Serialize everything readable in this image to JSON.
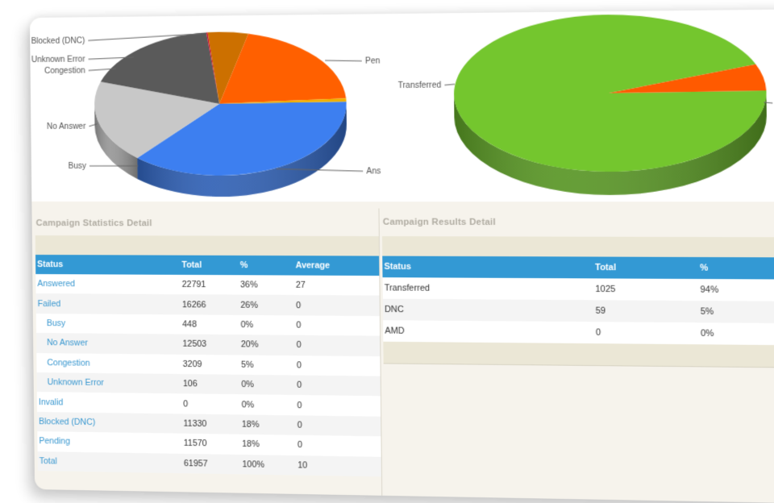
{
  "colors": {
    "header_blue": "#3399d4",
    "link_blue": "#3a98d0",
    "band_beige": "#ebe7d6",
    "background": "#f6f3ec"
  },
  "chart_data": [
    {
      "type": "pie",
      "title": "Campaign Statistics",
      "style": "3d",
      "slices": [
        {
          "label": "Answered",
          "short_label": "Ans",
          "value": 22791,
          "percent": 36,
          "color": "#3d7ff0"
        },
        {
          "label": "Pending",
          "short_label": "Pen",
          "value": 11570,
          "percent": 18,
          "color": "#c8c8c8"
        },
        {
          "label": "Blocked (DNC)",
          "short_label": "Blocked (DNC)",
          "value": 11330,
          "percent": 18,
          "color": "#5a5a5a"
        },
        {
          "label": "Unknown Error",
          "short_label": "Unknown Error",
          "value": 106,
          "percent": 0,
          "color": "#cc1133"
        },
        {
          "label": "Congestion",
          "short_label": "Congestion",
          "value": 3209,
          "percent": 5,
          "color": "#cc7000"
        },
        {
          "label": "No Answer",
          "short_label": "No Answer",
          "value": 12503,
          "percent": 20,
          "color": "#ff6000"
        },
        {
          "label": "Busy",
          "short_label": "Busy",
          "value": 448,
          "percent": 0,
          "color": "#f0b000"
        }
      ]
    },
    {
      "type": "pie",
      "title": "Campaign Results",
      "style": "3d",
      "slices": [
        {
          "label": "Transferred",
          "short_label": "Transferred",
          "value": 1025,
          "percent": 94,
          "color": "#74c62e"
        },
        {
          "label": "DNC",
          "short_label": "DNC",
          "value": 59,
          "percent": 5,
          "color": "#ff5a00"
        },
        {
          "label": "AMD",
          "short_label": "AMD",
          "value": 0,
          "percent": 0,
          "color": "#999999"
        }
      ]
    }
  ],
  "stats": {
    "title": "Campaign Statistics Detail",
    "columns": [
      "Status",
      "Total",
      "%",
      "Average"
    ],
    "rows": [
      {
        "status": "Answered",
        "total": "22791",
        "pct": "36%",
        "avg": "27",
        "indent": false
      },
      {
        "status": "Failed",
        "total": "16266",
        "pct": "26%",
        "avg": "0",
        "indent": false
      },
      {
        "status": "Busy",
        "total": "448",
        "pct": "0%",
        "avg": "0",
        "indent": true
      },
      {
        "status": "No Answer",
        "total": "12503",
        "pct": "20%",
        "avg": "0",
        "indent": true
      },
      {
        "status": "Congestion",
        "total": "3209",
        "pct": "5%",
        "avg": "0",
        "indent": true
      },
      {
        "status": "Unknown Error",
        "total": "106",
        "pct": "0%",
        "avg": "0",
        "indent": true
      },
      {
        "status": "Invalid",
        "total": "0",
        "pct": "0%",
        "avg": "0",
        "indent": false
      },
      {
        "status": "Blocked (DNC)",
        "total": "11330",
        "pct": "18%",
        "avg": "0",
        "indent": false
      },
      {
        "status": "Pending",
        "total": "11570",
        "pct": "18%",
        "avg": "0",
        "indent": false
      },
      {
        "status": "Total",
        "total": "61957",
        "pct": "100%",
        "avg": "10",
        "indent": false
      }
    ]
  },
  "results": {
    "title": "Campaign Results Detail",
    "columns": [
      "Status",
      "Total",
      "%"
    ],
    "rows": [
      {
        "status": "Transferred",
        "total": "1025",
        "pct": "94%"
      },
      {
        "status": "DNC",
        "total": "59",
        "pct": "5%"
      },
      {
        "status": "AMD",
        "total": "0",
        "pct": "0%"
      }
    ]
  }
}
